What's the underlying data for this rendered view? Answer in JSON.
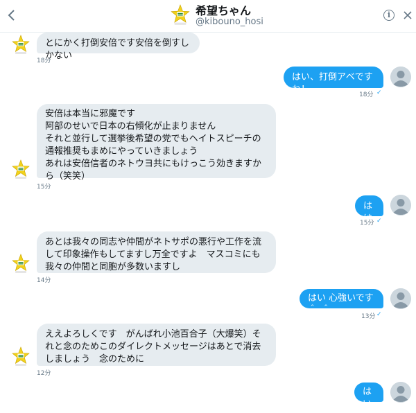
{
  "header": {
    "name": "希望ちゃん",
    "handle": "@kibouno_hosi",
    "info_icon": "i",
    "avatar_label": "希望"
  },
  "messages": [
    {
      "side": "in",
      "text": "とにかく打倒安倍です安倍を倒すしかない",
      "time": "18分"
    },
    {
      "side": "out",
      "text": "はい、打倒アベですね！",
      "time": "18分"
    },
    {
      "side": "in",
      "text": "安倍は本当に邪魔です\n阿部のせいで日本の右傾化が止まりません\nそれと並行して選挙後希望の党でもヘイトスピーチの通報推奨もまめにやっていきましょう\nあれは安倍信者のネトウヨ共にもけっこう効きますから（笑笑）",
      "time": "15分"
    },
    {
      "side": "out",
      "text": "はは",
      "time": "15分"
    },
    {
      "side": "in",
      "text": "あとは我々の同志や仲間がネトサポの悪行や工作を流して印象操作もしてますし万全ですよ　マスコミにも我々の仲間と同胞が多数いますし",
      "time": "14分"
    },
    {
      "side": "out",
      "text": "はい 心強いです＾_＾",
      "time": "13分"
    },
    {
      "side": "in",
      "text": "ええよろしくです　がんばれ小池百合子（大爆笑）それと念のためこのダイレクトメッセージはあとで消去しましょう　念のために",
      "time": "12分"
    },
    {
      "side": "out",
      "text": "はい",
      "time": ""
    }
  ],
  "read_mark": "✓",
  "colors": {
    "accent": "#1da1f2",
    "incoming_bg": "#e6ecf0",
    "muted": "#657786"
  }
}
